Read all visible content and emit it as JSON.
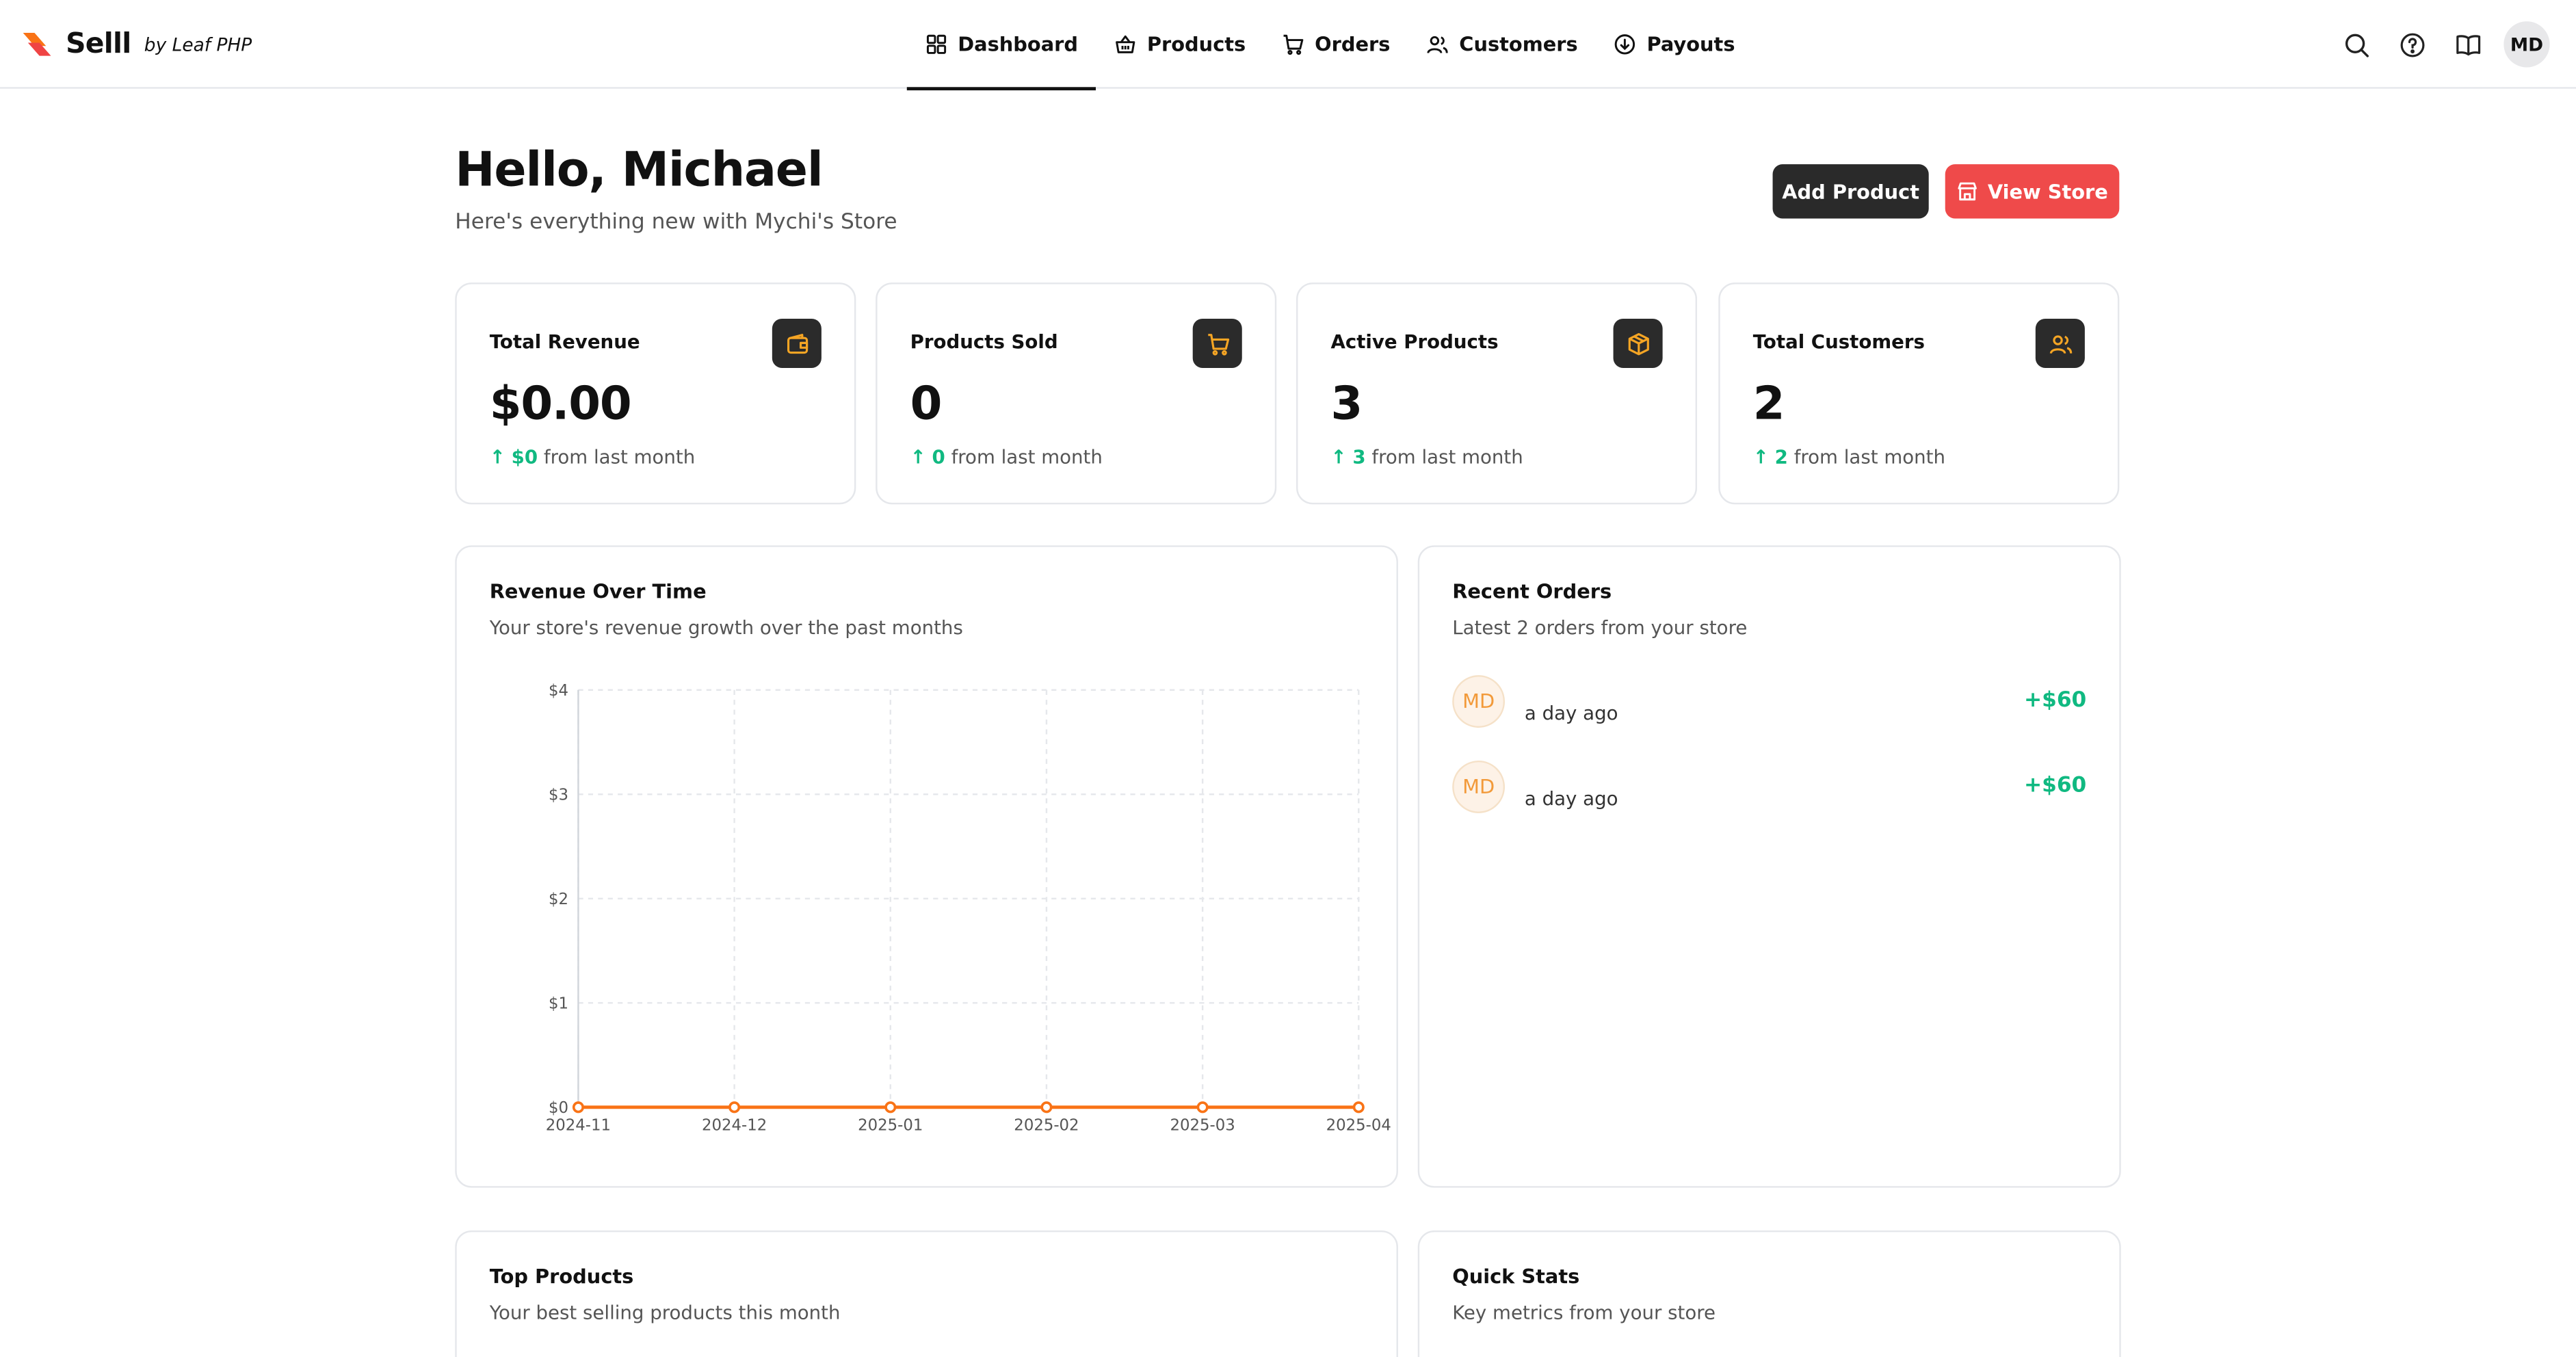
{
  "brand": {
    "name": "Selll",
    "by": "by Leaf PHP"
  },
  "nav": {
    "items": [
      {
        "label": "Dashboard",
        "icon": "grid-icon",
        "active": true
      },
      {
        "label": "Products",
        "icon": "basket-icon"
      },
      {
        "label": "Orders",
        "icon": "cart-icon"
      },
      {
        "label": "Customers",
        "icon": "users-icon"
      },
      {
        "label": "Payouts",
        "icon": "payout-icon"
      }
    ]
  },
  "top_actions": {
    "avatar_initials": "MD",
    "icons": [
      "search-icon",
      "help-icon",
      "book-icon"
    ]
  },
  "header": {
    "greeting": "Hello, Michael",
    "subtitle": "Here's everything new with Mychi's Store",
    "add_product_label": "Add Product",
    "view_store_label": "View Store"
  },
  "stats": [
    {
      "label": "Total Revenue",
      "value": "$0.00",
      "change": "$0",
      "suffix": "from last month",
      "icon": "wallet-icon"
    },
    {
      "label": "Products Sold",
      "value": "0",
      "change": "0",
      "suffix": "from last month",
      "icon": "cart-icon"
    },
    {
      "label": "Active Products",
      "value": "3",
      "change": "3",
      "suffix": "from last month",
      "icon": "box-icon"
    },
    {
      "label": "Total Customers",
      "value": "2",
      "change": "2",
      "suffix": "from last month",
      "icon": "users-icon"
    }
  ],
  "revenue_panel": {
    "title": "Revenue Over Time",
    "subtitle": "Your store's revenue growth over the past months"
  },
  "chart_data": {
    "type": "line",
    "x": [
      "2024-11",
      "2024-12",
      "2025-01",
      "2025-02",
      "2025-03",
      "2025-04"
    ],
    "series": [
      {
        "values": [
          0,
          0,
          0,
          0,
          0,
          0
        ]
      }
    ],
    "y_ticks": [
      "$0",
      "$1",
      "$2",
      "$3",
      "$4"
    ],
    "ylim": [
      0,
      4
    ],
    "grid": true,
    "color": "#f97316"
  },
  "recent_orders": {
    "title": "Recent Orders",
    "subtitle": "Latest 2 orders from your store",
    "orders": [
      {
        "initials": "MD",
        "time": "a day ago",
        "amount": "+$60"
      },
      {
        "initials": "MD",
        "time": "a day ago",
        "amount": "+$60"
      }
    ]
  },
  "top_products": {
    "title": "Top Products",
    "subtitle": "Your best selling products this month"
  },
  "quick_stats": {
    "title": "Quick Stats",
    "subtitle": "Key metrics from your store"
  },
  "colors": {
    "accent": "#ef4a4a",
    "positive": "#10b981",
    "icon_accent": "#f5a524",
    "line": "#f97316"
  }
}
